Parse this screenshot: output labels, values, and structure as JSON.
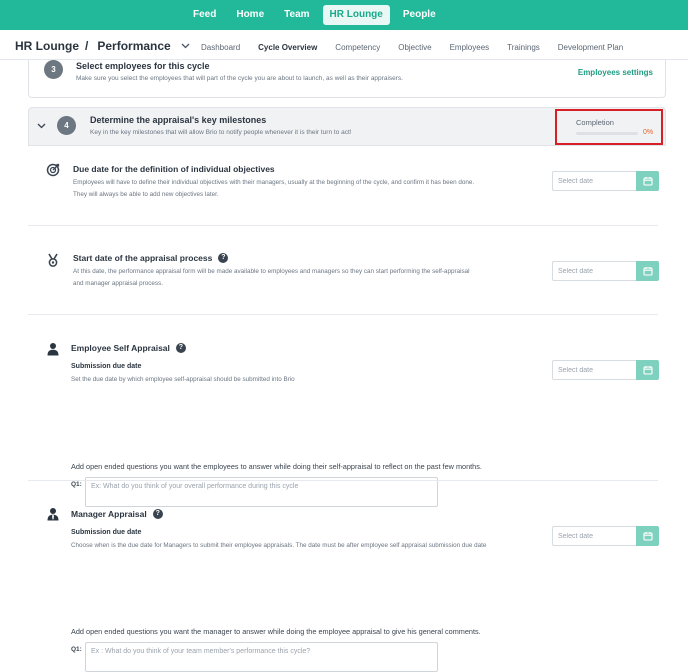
{
  "topnav": {
    "items": [
      {
        "label": "Feed"
      },
      {
        "label": "Home"
      },
      {
        "label": "Team"
      },
      {
        "label": "HR Lounge",
        "active": true
      },
      {
        "label": "People"
      }
    ]
  },
  "breadcrumb": {
    "root": "HR Lounge",
    "separator": "/",
    "current": "Performance"
  },
  "subnav": {
    "items": [
      "Dashboard",
      "Cycle Overview",
      "Competency",
      "Objective",
      "Employees",
      "Trainings",
      "Development Plan"
    ]
  },
  "step3": {
    "number": "3",
    "title": "Select employees for this cycle",
    "description": "Make sure you select the employees that will part of the cycle you are about to launch, as well as their appraisers.",
    "link": "Employees settings"
  },
  "step4": {
    "number": "4",
    "title": "Determine the appraisal's key milestones",
    "description": "Key in the key milestones that will allow Brio to notify people whenever it is their turn to act!",
    "completion_label": "Completion",
    "completion_value": "0%",
    "completion_fraction": 0
  },
  "sections": {
    "objectives": {
      "title": "Due date for the definition of individual objectives",
      "desc1": "Employees will have to define their individual objectives with their managers, usually at the beginning of the cycle, and confirm it has been done.",
      "desc2": "They will always be able to add new objectives later.",
      "date_placeholder": "Select date"
    },
    "appraisal_start": {
      "title": "Start date of the appraisal process",
      "desc1": "At this date, the performance appraisal form will be made available to employees and managers so they can start performing the self-appraisal",
      "desc2": "and manager appraisal process.",
      "date_placeholder": "Select date"
    },
    "self_appraisal": {
      "title": "Employee Self Appraisal",
      "sub_title": "Submission due date",
      "sub_desc": "Set the due date by which employee self-appraisal should be submitted into Brio",
      "prompt": "Add open ended questions you want the employees to answer while doing their self-appraisal to reflect on the past few months.",
      "q_label": "Q1:",
      "q_placeholder": "Ex: What do you think of your overall performance during this cycle",
      "date_placeholder": "Select date"
    },
    "manager_appraisal": {
      "title": "Manager Appraisal",
      "sub_title": "Submission due date",
      "sub_desc": "Choose when is the due date for Managers to submit their employee appraisals. The date must be after employee self appraisal submission due date",
      "prompt": "Add open ended questions you want the manager to answer while doing the employee appraisal to give his general comments.",
      "q_label": "Q1:",
      "q_placeholder": "Ex : What do you think of your team member's performance this cycle?",
      "date_placeholder": "Select date"
    }
  },
  "colors": {
    "brand": "#22b99a",
    "highlight_border": "#d81f26",
    "completion_value": "#e8622b"
  }
}
